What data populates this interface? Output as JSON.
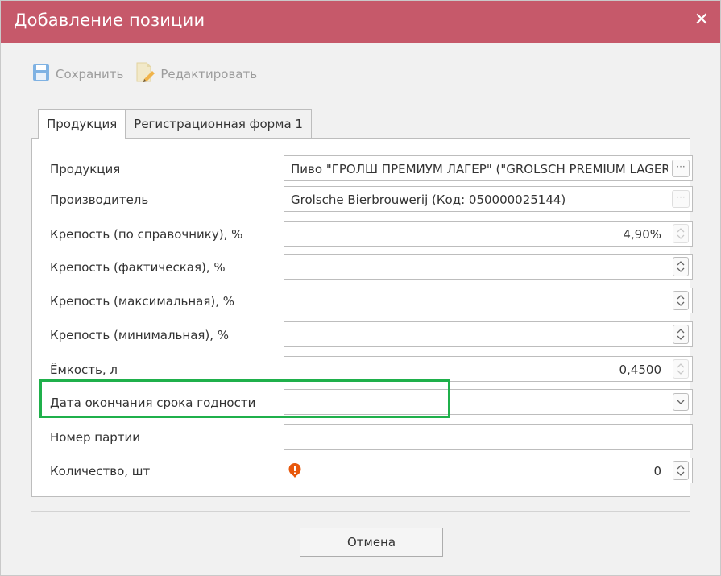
{
  "dialog": {
    "title": "Добавление позиции"
  },
  "toolbar": {
    "save_label": "Сохранить",
    "edit_label": "Редактировать"
  },
  "tabs": [
    {
      "label": "Продукция",
      "active": true
    },
    {
      "label": "Регистрационная форма 1",
      "active": false
    }
  ],
  "form": {
    "product": {
      "label": "Продукция",
      "value": "Пиво \"ГРОЛШ ПРЕМИУМ ЛАГЕР\" (\"GROLSCH PREMIUM LAGER\")"
    },
    "producer": {
      "label": "Производитель",
      "value": "Grolsche Bierbrouwerij (Код: 050000025144)"
    },
    "strength_ref": {
      "label": "Крепость (по справочнику), %",
      "value": "4,90%"
    },
    "strength_actual": {
      "label": "Крепость (фактическая), %",
      "value": ""
    },
    "strength_max": {
      "label": "Крепость (максимальная), %",
      "value": ""
    },
    "strength_min": {
      "label": "Крепость (минимальная), %",
      "value": ""
    },
    "volume": {
      "label": "Ёмкость, л",
      "value": "0,4500"
    },
    "expiry_date": {
      "label": "Дата окончания срока годности",
      "value": ""
    },
    "batch_number": {
      "label": "Номер партии",
      "value": ""
    },
    "quantity": {
      "label": "Количество, шт",
      "value": "0"
    }
  },
  "footer": {
    "cancel_label": "Отмена"
  },
  "colors": {
    "titlebar": "#c6596a",
    "highlight": "#1fb04b",
    "warning": "#e8580c",
    "save_icon": "#5b9bd5"
  }
}
